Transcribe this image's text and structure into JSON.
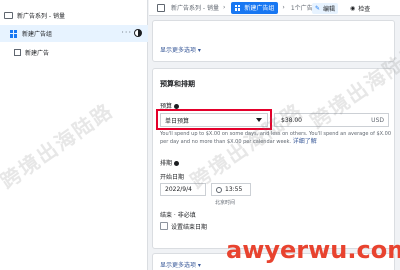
{
  "sidebar": {
    "items": [
      {
        "label": "新广告系列 - 销量",
        "type": "campaign"
      },
      {
        "label": "新建广告组",
        "type": "adset",
        "selected": true
      },
      {
        "label": "新建广告",
        "type": "ad"
      }
    ],
    "more": "···"
  },
  "header": {
    "crumb_campaign": "新广告系列 - 销量",
    "crumb_adset": "新建广告组",
    "crumb_ad": "1个广告",
    "edit_label": "编辑",
    "review_label": "检查"
  },
  "card1": {
    "link": "显示更多选项 ▾"
  },
  "budget": {
    "title": "预算和排期",
    "budget_label": "预算",
    "budget_type": "单日预算",
    "amount": "$38.00",
    "currency": "USD",
    "help": "You'll spend up to $X.00 on some days, and less on others. You'll spend an average of $X.00 per day and no more than $X.00 per calendar week.",
    "help_link": "详细了解",
    "schedule_label": "排期",
    "start_label": "开始日期",
    "start_date": "2022/9/4",
    "start_time": "13:55",
    "timezone": "北京时间",
    "end_label": "结束 · 非必填",
    "end_checkbox_label": "设置结束日期"
  },
  "card3": {
    "link": "显示更多选项 ▾"
  },
  "watermarks": {
    "text": "跨境出海陆路",
    "brand": "awyerwu.com"
  }
}
